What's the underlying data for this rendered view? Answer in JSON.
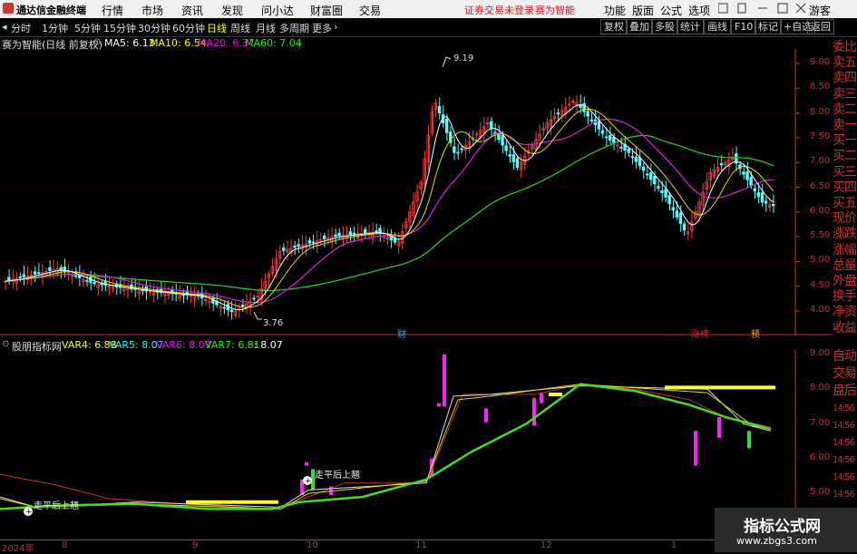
{
  "menubar": {
    "app_name": "通达信金融终端",
    "items": [
      "行情",
      "市场",
      "资讯",
      "发现",
      "问小达",
      "财富圈",
      "交易"
    ],
    "warning": "证券交易未登录",
    "stock_name": "赛为智能",
    "right_items": [
      "功能",
      "版面",
      "公式",
      "选项"
    ],
    "guest": "游客"
  },
  "toolbar": {
    "periods": [
      "分时",
      "1分钟",
      "5分钟",
      "15分钟",
      "30分钟",
      "60分钟",
      "日线",
      "周线",
      "月线",
      "多周期",
      "更多"
    ],
    "active_period": "日线",
    "right_buttons": [
      "复权",
      "叠加",
      "多股",
      "统计",
      "画线",
      "F10",
      "标记",
      "+自选",
      "返回"
    ]
  },
  "main_chart": {
    "title": "赛为智能(日线 前复权)",
    "ma": [
      {
        "label": "MA5: 6.13",
        "color": "#ffffff"
      },
      {
        "label": "MA10: 6.54",
        "color": "#ffff00"
      },
      {
        "label": "MA20: 6.37",
        "color": "#ff00ff"
      },
      {
        "label": "MA60: 7.04",
        "color": "#00ff00"
      }
    ],
    "y_ticks": [
      "9.00",
      "8.50",
      "8.00",
      "7.50",
      "7.00",
      "6.50",
      "6.00",
      "5.50",
      "5.00",
      "4.50",
      "4.00"
    ],
    "high_label": "9.19",
    "low_label": "3.76",
    "markers": [
      "财",
      "涨榜",
      "预"
    ]
  },
  "sub_chart": {
    "title": "股朋指标网",
    "vars": [
      {
        "label": "VAR4: 6.88",
        "color": "#ffff00"
      },
      {
        "label": "VAR5: 8.07",
        "color": "#00ffff"
      },
      {
        "label": "VAR6: 8.07",
        "color": "#ff00ff"
      },
      {
        "label": "VAR7: 6.81",
        "color": "#00ff00"
      },
      {
        "label": ": 8.07",
        "color": "#ffffff"
      }
    ],
    "y_ticks": [
      "9.00",
      "8.00",
      "7.00",
      "6.00",
      "5.00"
    ],
    "annotation_1": "走平后上翘",
    "annotation_2": "走平后上翘"
  },
  "right_panel": [
    "委比",
    "卖五",
    "卖四",
    "卖三",
    "卖二",
    "卖一",
    "买一",
    "买二",
    "买三",
    "买四",
    "买五",
    "现价",
    "涨跌",
    "涨幅",
    "总量",
    "外盘",
    "换手",
    "净资",
    "收益",
    "自动",
    "交易",
    "盘后",
    "14:56",
    "14:56",
    "14:56",
    "14:56",
    "14:56",
    "14:56"
  ],
  "x_axis": {
    "year": "2024年",
    "months": [
      "8",
      "9",
      "10",
      "11",
      "12",
      "1"
    ]
  },
  "watermark": {
    "title": "指标公式网",
    "url": "www.zbgs3.com"
  }
}
